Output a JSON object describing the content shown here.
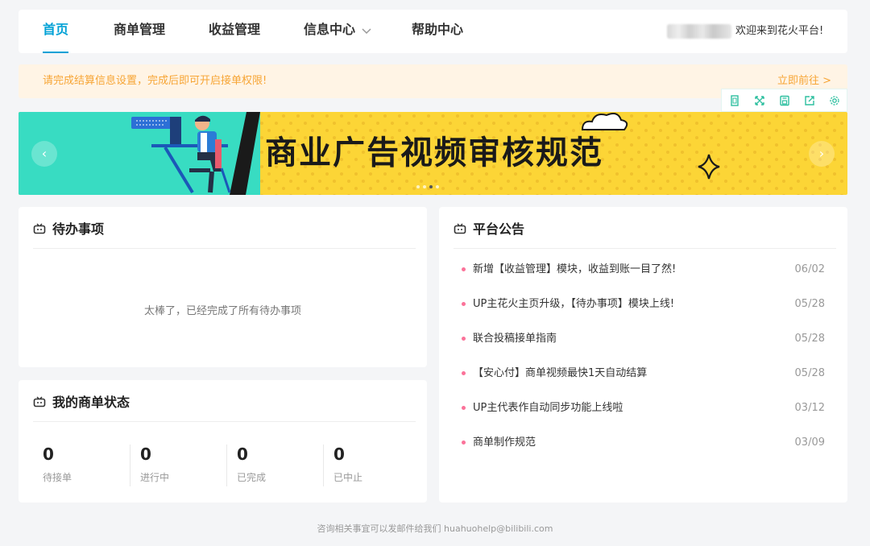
{
  "nav": {
    "items": [
      {
        "label": "首页"
      },
      {
        "label": "商单管理"
      },
      {
        "label": "收益管理"
      },
      {
        "label": "信息中心"
      },
      {
        "label": "帮助中心"
      }
    ],
    "welcome": "欢迎来到花火平台!"
  },
  "notice": {
    "text": "请完成结算信息设置，完成后即可开启接单权限!",
    "link": "立即前往 >"
  },
  "toolbar": {
    "icons": [
      "crop-icon",
      "expand-icon",
      "save-icon",
      "share-icon",
      "settings-icon"
    ]
  },
  "banner": {
    "title": "商业广告视频审核规范",
    "prev": "‹",
    "next": "›"
  },
  "todo": {
    "title": "待办事项",
    "empty": "太棒了，已经完成了所有待办事项"
  },
  "orders": {
    "title": "我的商单状态",
    "stats": [
      {
        "value": "0",
        "label": "待接单"
      },
      {
        "value": "0",
        "label": "进行中"
      },
      {
        "value": "0",
        "label": "已完成"
      },
      {
        "value": "0",
        "label": "已中止"
      }
    ]
  },
  "announcements": {
    "title": "平台公告",
    "items": [
      {
        "text": "新增【收益管理】模块，收益到账一目了然!",
        "date": "06/02"
      },
      {
        "text": "UP主花火主页升级，【待办事项】模块上线!",
        "date": "05/28"
      },
      {
        "text": "联合投稿接单指南",
        "date": "05/28"
      },
      {
        "text": "【安心付】商单视频最快1天自动结算",
        "date": "05/28"
      },
      {
        "text": "UP主代表作自动同步功能上线啦",
        "date": "03/12"
      },
      {
        "text": "商单制作规范",
        "date": "03/09"
      }
    ]
  },
  "footer": {
    "text": "咨询相关事宜可以发邮件给我们 huahuohelp@bilibili.com"
  },
  "colors": {
    "accent": "#00a1d6",
    "notice": "#f7a535",
    "bullet": "#fb7299",
    "banner_yellow": "#fcd536",
    "banner_teal": "#38dcc2"
  }
}
